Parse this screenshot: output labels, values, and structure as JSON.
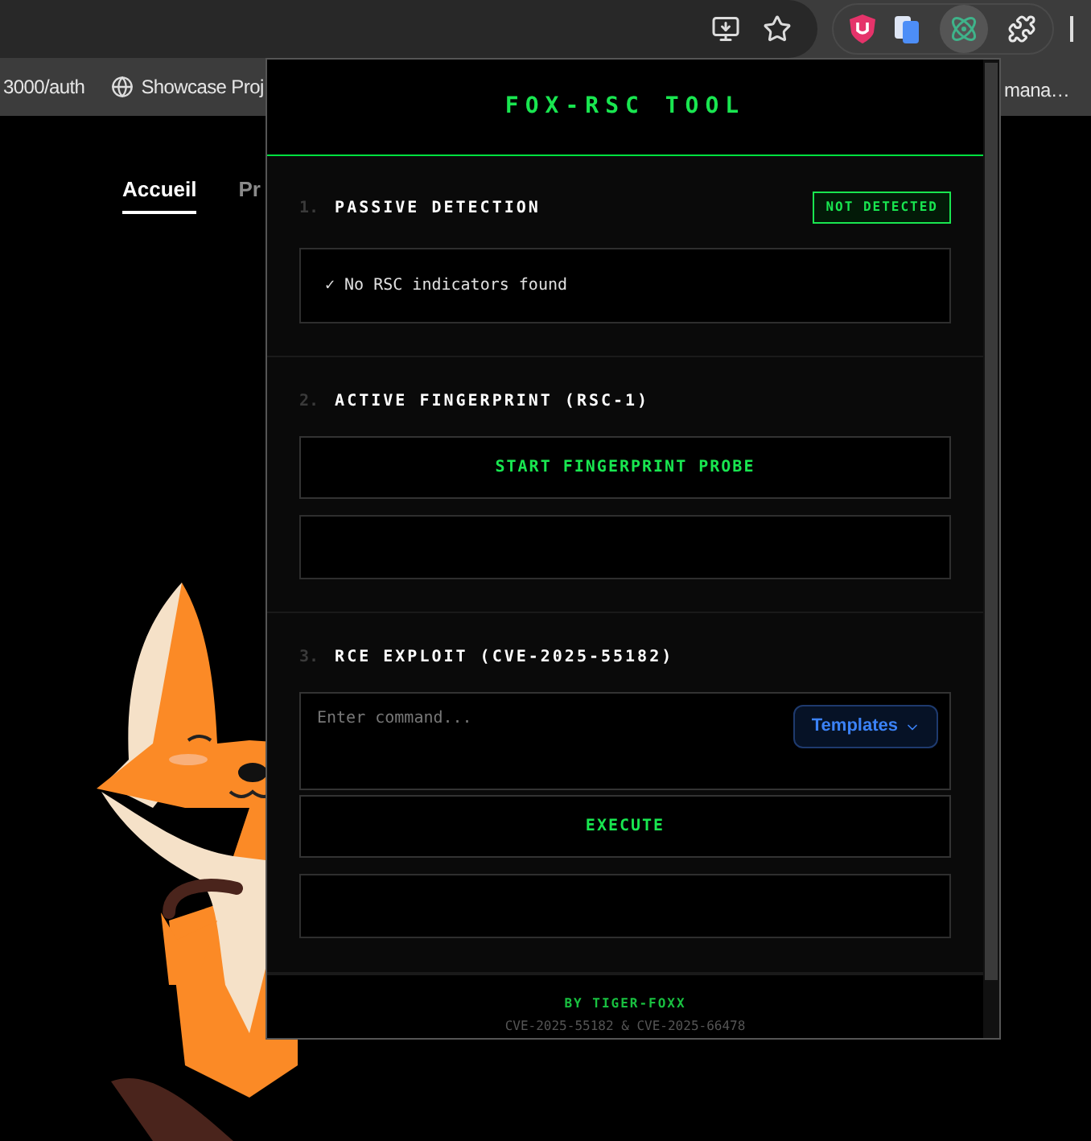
{
  "browser": {
    "bookmarks": [
      {
        "label": "3000/auth",
        "kind": "plain"
      },
      {
        "label": "Showcase Proj",
        "kind": "globe"
      }
    ],
    "bookmark_right": "mana…"
  },
  "page": {
    "nav": [
      {
        "label": "Accueil",
        "selected": true
      },
      {
        "label": "Pr",
        "selected": false
      }
    ]
  },
  "popup": {
    "title": "FOX-RSC TOOL",
    "passive": {
      "number": "1.",
      "title": "PASSIVE DETECTION",
      "badge": "NOT DETECTED",
      "result": "✓ No RSC indicators found"
    },
    "fingerprint": {
      "number": "2.",
      "title": "ACTIVE FINGERPRINT (RSC-1)",
      "button": "START FINGERPRINT PROBE"
    },
    "exploit": {
      "number": "3.",
      "title": "RCE EXPLOIT (CVE-2025-55182)",
      "placeholder": "Enter command...",
      "templates": "Templates",
      "button": "EXECUTE"
    },
    "footer": {
      "credit": "BY TIGER-FOXX",
      "note": "CVE-2025-55182 & CVE-2025-66478"
    }
  }
}
